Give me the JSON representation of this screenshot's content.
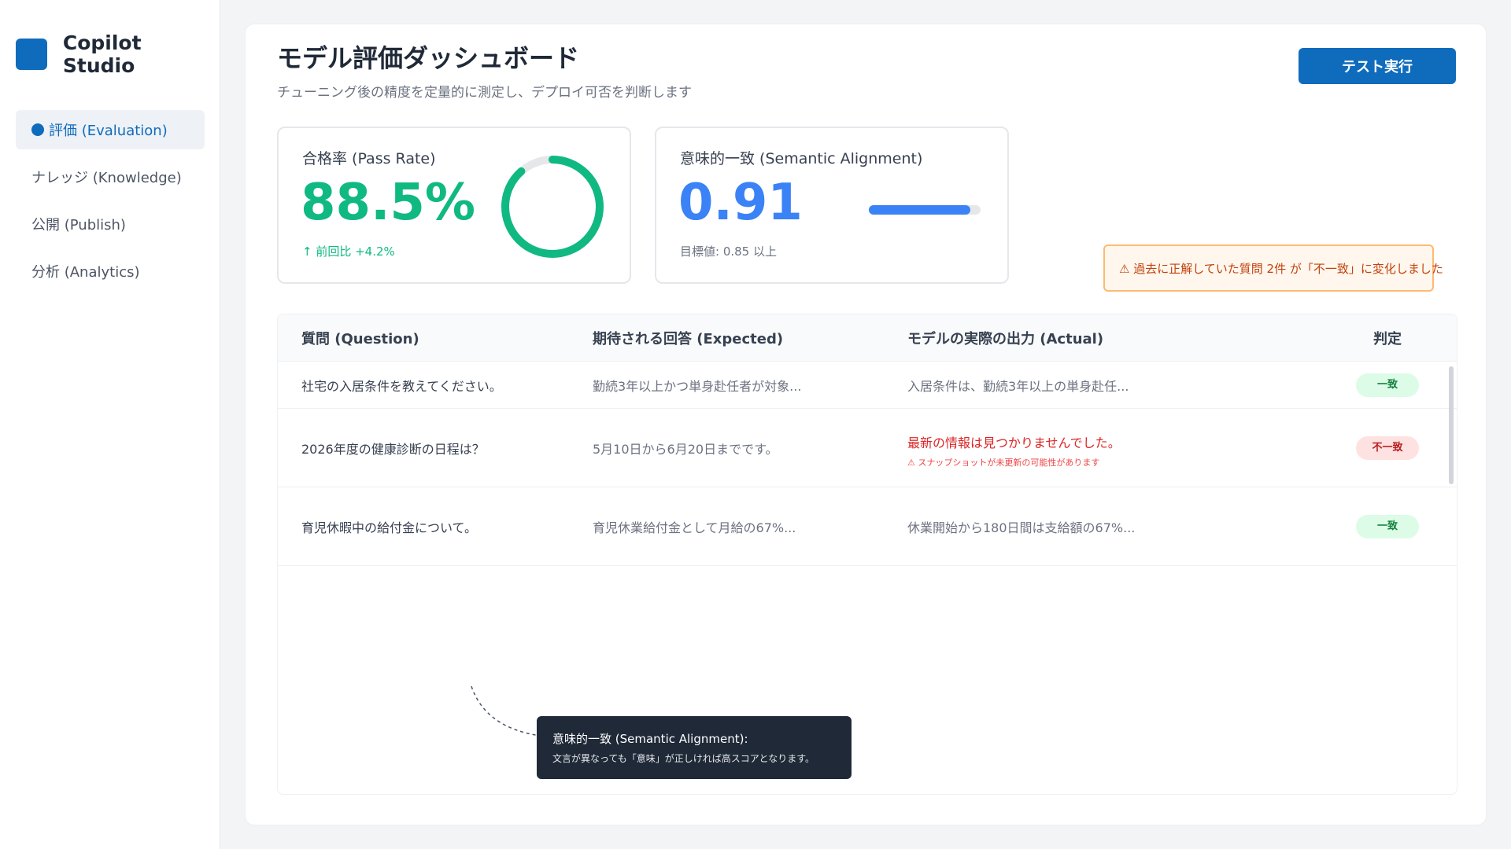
{
  "app": {
    "name": "Copilot Studio"
  },
  "sidebar": {
    "items": [
      {
        "label": "評価 (Evaluation)",
        "active": true
      },
      {
        "label": "ナレッジ (Knowledge)",
        "active": false
      },
      {
        "label": "公開 (Publish)",
        "active": false
      },
      {
        "label": "分析 (Analytics)",
        "active": false
      }
    ]
  },
  "header": {
    "title": "モデル評価ダッシュボード",
    "subtitle": "チューニング後の精度を定量的に測定し、デプロイ可否を判断します",
    "run_button": "テスト実行"
  },
  "metrics": {
    "pass_rate": {
      "label": "合格率 (Pass Rate)",
      "value": "88.5%",
      "fraction": 0.885,
      "note": "↑ 前回比 +4.2%"
    },
    "semantic": {
      "label": "意味的一致 (Semantic Alignment)",
      "value": "0.91",
      "fraction": 0.91,
      "note": "目標値: 0.85 以上"
    }
  },
  "alert": {
    "icon": "warning-icon",
    "text": "⚠ 過去に正解していた質問 2件 が「不一致」に変化しました"
  },
  "table": {
    "headers": {
      "question": "質問 (Question)",
      "expected": "期待される回答 (Expected)",
      "actual": "モデルの実際の出力 (Actual)",
      "verdict": "判定"
    },
    "rows": [
      {
        "question": "社宅の入居条件を教えてください。",
        "expected": "勤続3年以上かつ単身赴任者が対象...",
        "actual": "入居条件は、勤続3年以上の単身赴任...",
        "actual_note": "",
        "verdict": "一致",
        "status": "ok"
      },
      {
        "question": "2026年度の健康診断の日程は？",
        "expected": "5月10日から6月20日までです。",
        "actual": "最新の情報は見つかりませんでした。",
        "actual_note": "⚠ スナップショットが未更新の可能性があります",
        "verdict": "不一致",
        "status": "ng"
      },
      {
        "question": "育児休暇中の給付金について。",
        "expected": "育児休業給付金として月給の67%...",
        "actual": "休業開始から180日間は支給額の67%...",
        "actual_note": "",
        "verdict": "一致",
        "status": "ok"
      }
    ]
  },
  "tooltip": {
    "title": "意味的一致 (Semantic Alignment):",
    "body": "文言が異なっても「意味」が正しければ高スコアとなります。"
  },
  "colors": {
    "brand": "#0f6cbd",
    "success": "#10b981",
    "accent": "#3b82f6",
    "danger": "#dc2626",
    "warning": "#c2410c"
  }
}
